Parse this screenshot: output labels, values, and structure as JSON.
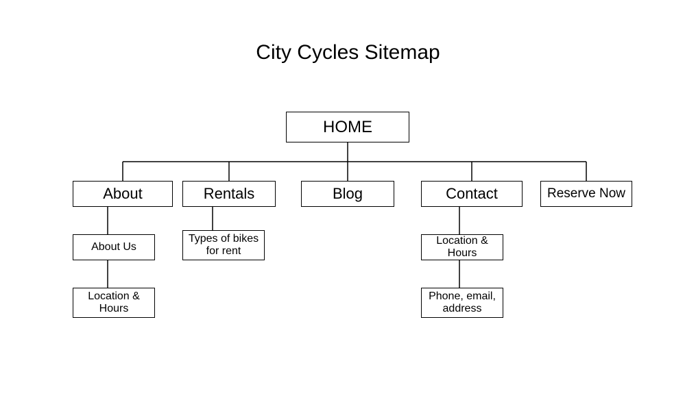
{
  "title": "City Cycles Sitemap",
  "root": {
    "label": "HOME"
  },
  "level1": {
    "about": {
      "label": "About"
    },
    "rentals": {
      "label": "Rentals"
    },
    "blog": {
      "label": "Blog"
    },
    "contact": {
      "label": "Contact"
    },
    "reserveNow": {
      "label": "Reserve Now"
    }
  },
  "children": {
    "about": [
      {
        "label": "About Us"
      },
      {
        "label": "Location & Hours"
      }
    ],
    "rentals": [
      {
        "label": "Types of bikes for rent"
      }
    ],
    "contact": [
      {
        "label": "Location & Hours"
      },
      {
        "label": "Phone, email, address"
      }
    ]
  }
}
